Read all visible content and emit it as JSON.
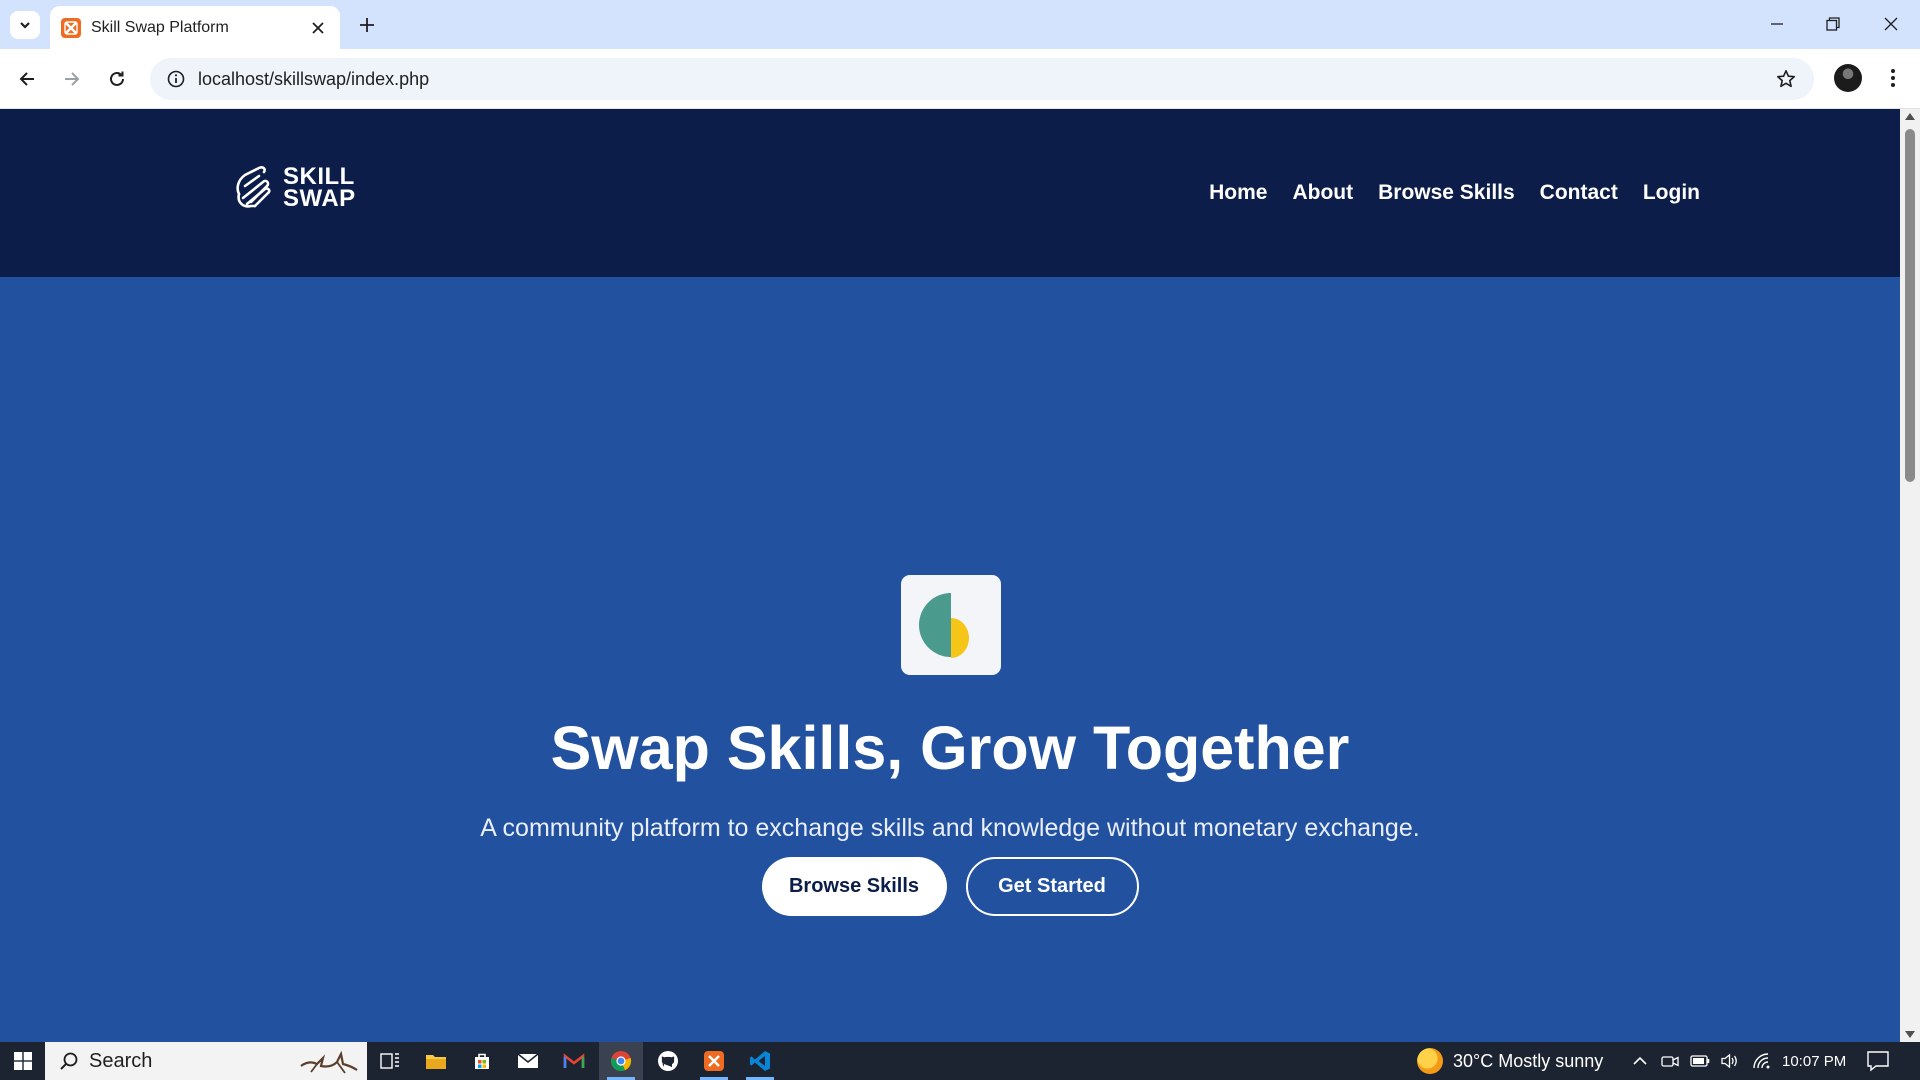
{
  "browser": {
    "tab_title": "Skill Swap Platform",
    "url": "localhost/skillswap/index.php"
  },
  "site": {
    "logo_line1": "SKILL",
    "logo_line2": "SWAP",
    "nav": [
      "Home",
      "About",
      "Browse Skills",
      "Contact",
      "Login"
    ]
  },
  "hero": {
    "title": "Swap Skills, Grow Together",
    "subtitle": "A community platform to exchange skills and knowledge without monetary exchange.",
    "primary_button": "Browse Skills",
    "secondary_button": "Get Started",
    "icon_colors": {
      "left": "#4a9a8e",
      "right": "#f5c518"
    }
  },
  "colors": {
    "header_bg": "#0b1d48",
    "hero_bg": "#2251a0",
    "tab_strip": "#d3e3fd"
  },
  "taskbar": {
    "search_label": "Search",
    "weather": "30°C  Mostly sunny",
    "time": "10:07 PM",
    "apps": [
      "task-view-icon",
      "file-explorer-icon",
      "store-icon",
      "mail-icon",
      "gmail-icon",
      "chrome-icon",
      "github-icon",
      "xampp-icon",
      "vscode-icon"
    ]
  }
}
